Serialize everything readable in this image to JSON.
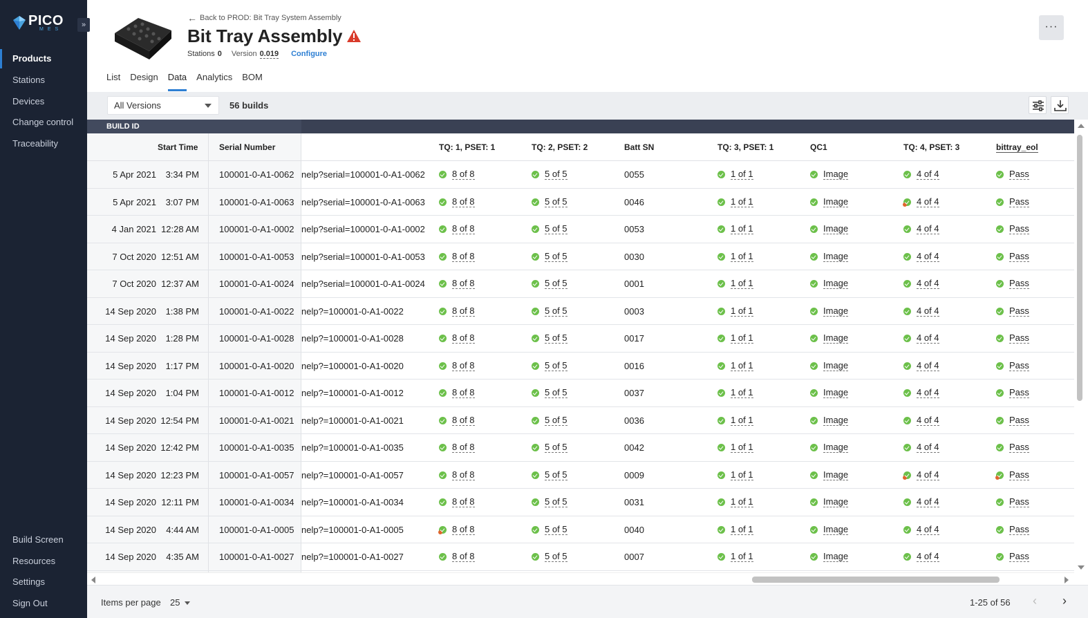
{
  "app": {
    "logo_text": "PICO",
    "logo_sub": "MES",
    "collapse_glyph": "»"
  },
  "sidebar": {
    "top_items": [
      {
        "label": "Products",
        "active": true
      },
      {
        "label": "Stations"
      },
      {
        "label": "Devices"
      },
      {
        "label": "Change control"
      },
      {
        "label": "Traceability"
      }
    ],
    "bottom_items": [
      {
        "label": "Build Screen"
      },
      {
        "label": "Resources"
      },
      {
        "label": "Settings"
      },
      {
        "label": "Sign Out"
      }
    ]
  },
  "header": {
    "back_label": "Back to PROD: Bit Tray System Assembly",
    "title": "Bit Tray Assembly",
    "warning_icon": "warning-triangle-icon",
    "stations_label": "Stations",
    "stations_value": "0",
    "version_label": "Version",
    "version_value": "0.019",
    "configure_label": "Configure",
    "more_label": "···"
  },
  "tabs": [
    "List",
    "Design",
    "Data",
    "Analytics",
    "BOM"
  ],
  "active_tab": "Data",
  "toolbar": {
    "version_select": "All Versions",
    "builds_count": "56 builds",
    "filter_icon": "sliders-icon",
    "download_icon": "download-icon"
  },
  "table": {
    "group_label": "BUILD ID",
    "columns": {
      "start_time": "Start Time",
      "serial": "Serial Number",
      "tq1": "TQ: 1, PSET: 1",
      "tq2": "TQ: 2, PSET: 2",
      "batt": "Batt SN",
      "tq3": "TQ: 3, PSET: 1",
      "qc1": "QC1",
      "tq4": "TQ: 4, PSET: 3",
      "eol": "bittray_eol"
    },
    "rows": [
      {
        "date": "5 Apr 2021",
        "time": "3:34 PM",
        "serial": "100001-0-A1-0062",
        "url": "nelp?serial=100001-0-A1-0062",
        "tq1": "8 of 8",
        "tq2": "5 of 5",
        "batt": "0055",
        "tq3": "1 of 1",
        "qc1": "Image",
        "tq4": "4 of 4",
        "eol": "Pass"
      },
      {
        "date": "5 Apr 2021",
        "time": "3:07 PM",
        "serial": "100001-0-A1-0063",
        "url": "nelp?serial=100001-0-A1-0063",
        "tq1": "8 of 8",
        "tq2": "5 of 5",
        "batt": "0046",
        "tq3": "1 of 1",
        "qc1": "Image",
        "tq4": "4 of 4",
        "tq4_warn": true,
        "eol": "Pass"
      },
      {
        "date": "4 Jan 2021",
        "time": "12:28 AM",
        "serial": "100001-0-A1-0002",
        "url": "nelp?serial=100001-0-A1-0002",
        "tq1": "8 of 8",
        "tq2": "5 of 5",
        "batt": "0053",
        "tq3": "1 of 1",
        "qc1": "Image",
        "tq4": "4 of 4",
        "eol": "Pass"
      },
      {
        "date": "7 Oct 2020",
        "time": "12:51 AM",
        "serial": "100001-0-A1-0053",
        "url": "nelp?serial=100001-0-A1-0053",
        "tq1": "8 of 8",
        "tq2": "5 of 5",
        "batt": "0030",
        "tq3": "1 of 1",
        "qc1": "Image",
        "tq4": "4 of 4",
        "eol": "Pass"
      },
      {
        "date": "7 Oct 2020",
        "time": "12:37 AM",
        "serial": "100001-0-A1-0024",
        "url": "nelp?serial=100001-0-A1-0024",
        "tq1": "8 of 8",
        "tq2": "5 of 5",
        "batt": "0001",
        "tq3": "1 of 1",
        "qc1": "Image",
        "tq4": "4 of 4",
        "eol": "Pass"
      },
      {
        "date": "14 Sep 2020",
        "time": "1:38 PM",
        "serial": "100001-0-A1-0022",
        "url": "nelp?=100001-0-A1-0022",
        "tq1": "8 of 8",
        "tq2": "5 of 5",
        "batt": "0003",
        "tq3": "1 of 1",
        "qc1": "Image",
        "tq4": "4 of 4",
        "eol": "Pass"
      },
      {
        "date": "14 Sep 2020",
        "time": "1:28 PM",
        "serial": "100001-0-A1-0028",
        "url": "nelp?=100001-0-A1-0028",
        "tq1": "8 of 8",
        "tq2": "5 of 5",
        "batt": "0017",
        "tq3": "1 of 1",
        "qc1": "Image",
        "tq4": "4 of 4",
        "eol": "Pass"
      },
      {
        "date": "14 Sep 2020",
        "time": "1:17 PM",
        "serial": "100001-0-A1-0020",
        "url": "nelp?=100001-0-A1-0020",
        "tq1": "8 of 8",
        "tq2": "5 of 5",
        "batt": "0016",
        "tq3": "1 of 1",
        "qc1": "Image",
        "tq4": "4 of 4",
        "eol": "Pass"
      },
      {
        "date": "14 Sep 2020",
        "time": "1:04 PM",
        "serial": "100001-0-A1-0012",
        "url": "nelp?=100001-0-A1-0012",
        "tq1": "8 of 8",
        "tq2": "5 of 5",
        "batt": "0037",
        "tq3": "1 of 1",
        "qc1": "Image",
        "tq4": "4 of 4",
        "eol": "Pass"
      },
      {
        "date": "14 Sep 2020",
        "time": "12:54 PM",
        "serial": "100001-0-A1-0021",
        "url": "nelp?=100001-0-A1-0021",
        "tq1": "8 of 8",
        "tq2": "5 of 5",
        "batt": "0036",
        "tq3": "1 of 1",
        "qc1": "Image",
        "tq4": "4 of 4",
        "eol": "Pass"
      },
      {
        "date": "14 Sep 2020",
        "time": "12:42 PM",
        "serial": "100001-0-A1-0035",
        "url": "nelp?=100001-0-A1-0035",
        "tq1": "8 of 8",
        "tq2": "5 of 5",
        "batt": "0042",
        "tq3": "1 of 1",
        "qc1": "Image",
        "tq4": "4 of 4",
        "eol": "Pass"
      },
      {
        "date": "14 Sep 2020",
        "time": "12:23 PM",
        "serial": "100001-0-A1-0057",
        "url": "nelp?=100001-0-A1-0057",
        "tq1": "8 of 8",
        "tq2": "5 of 5",
        "batt": "0009",
        "tq3": "1 of 1",
        "qc1": "Image",
        "tq4": "4 of 4",
        "tq4_warn": true,
        "eol": "Pass",
        "eol_warn": true
      },
      {
        "date": "14 Sep 2020",
        "time": "12:11 PM",
        "serial": "100001-0-A1-0034",
        "url": "nelp?=100001-0-A1-0034",
        "tq1": "8 of 8",
        "tq2": "5 of 5",
        "batt": "0031",
        "tq3": "1 of 1",
        "qc1": "Image",
        "tq4": "4 of 4",
        "eol": "Pass"
      },
      {
        "date": "14 Sep 2020",
        "time": "4:44 AM",
        "serial": "100001-0-A1-0005",
        "url": "nelp?=100001-0-A1-0005",
        "tq1": "8 of 8",
        "tq1_warn": true,
        "tq2": "5 of 5",
        "batt": "0040",
        "tq3": "1 of 1",
        "qc1": "Image",
        "tq4": "4 of 4",
        "eol": "Pass"
      },
      {
        "date": "14 Sep 2020",
        "time": "4:35 AM",
        "serial": "100001-0-A1-0027",
        "url": "nelp?=100001-0-A1-0027",
        "tq1": "8 of 8",
        "tq2": "5 of 5",
        "batt": "0007",
        "tq3": "1 of 1",
        "qc1": "Image",
        "tq4": "4 of 4",
        "eol": "Pass"
      }
    ]
  },
  "footer": {
    "items_per_page_label": "Items per page",
    "items_per_page_value": "25",
    "range": "1-25 of 56",
    "prev": "‹",
    "next": "›"
  },
  "colors": {
    "sidebar_bg": "#1b2333",
    "accent": "#2d7fd3",
    "ok": "#6cc04a",
    "warn": "#e0652e",
    "alert": "#d93b2b"
  }
}
